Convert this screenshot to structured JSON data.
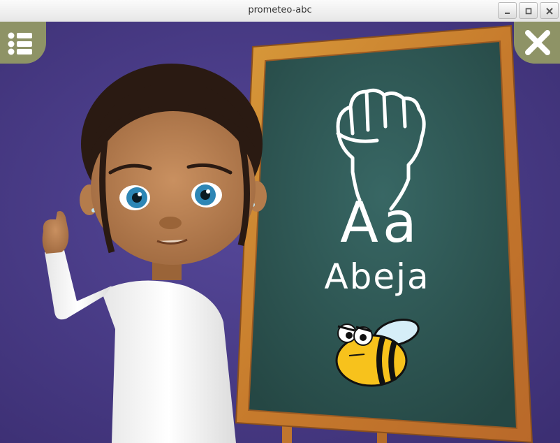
{
  "window": {
    "title": "prometeo-abc",
    "controls": [
      "minimize-icon",
      "maximize-icon",
      "close-icon"
    ]
  },
  "toolbar": {
    "menu_icon": "list-icon",
    "close_icon": "close-x-icon",
    "accent_color": "#8e9366"
  },
  "board": {
    "letter": "Aa",
    "word": "Abeja",
    "sign_icon": "fist-hand-sign-icon",
    "picture_icon": "bee-icon",
    "chalkboard_color": "#2f5a57"
  },
  "scene": {
    "background_color": "#4a3b86",
    "character": "girl-avatar"
  }
}
